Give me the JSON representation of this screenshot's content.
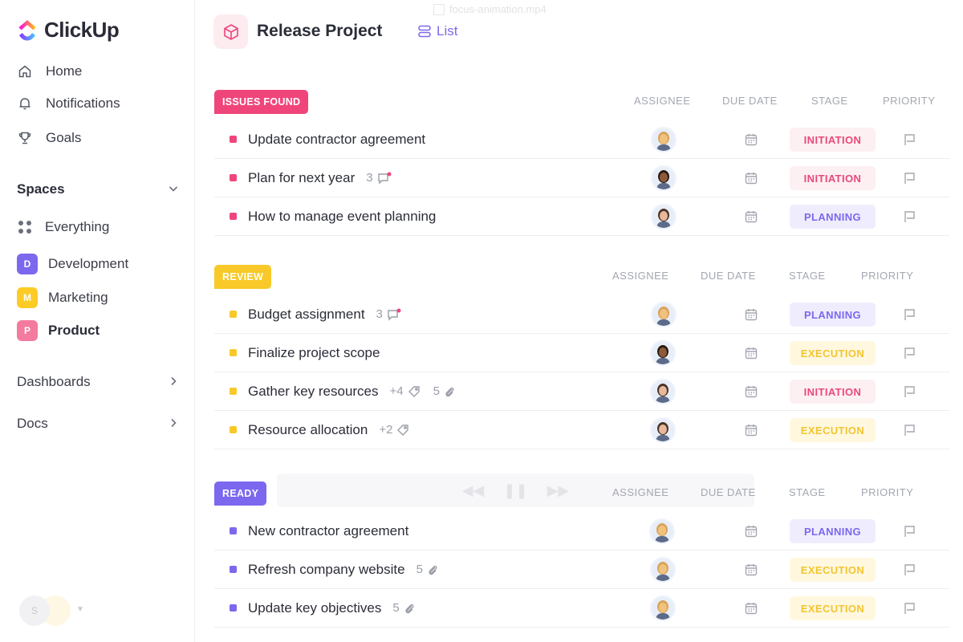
{
  "video": {
    "title": "focus-animation.mp4"
  },
  "sidebar": {
    "brand": "ClickUp",
    "nav": [
      {
        "label": "Home",
        "icon": "home-icon"
      },
      {
        "label": "Notifications",
        "icon": "bell-icon"
      },
      {
        "label": "Goals",
        "icon": "trophy-icon"
      }
    ],
    "spaces_label": "Spaces",
    "spaces": [
      {
        "label": "Everything",
        "letter": "",
        "color": ""
      },
      {
        "label": "Development",
        "letter": "D",
        "color": "#7b68ee"
      },
      {
        "label": "Marketing",
        "letter": "M",
        "color": "#fdcb26"
      },
      {
        "label": "Product",
        "letter": "P",
        "color": "#f47a9f"
      }
    ],
    "dashboards_label": "Dashboards",
    "docs_label": "Docs",
    "user_initial": "S"
  },
  "header": {
    "title": "Release Project",
    "view_tab": "List"
  },
  "columns": {
    "assignee": "ASSIGNEE",
    "due_date": "DUE DATE",
    "stage": "STAGE",
    "priority": "PRIORITY"
  },
  "groups": [
    {
      "label": "ISSUES FOUND",
      "color": "#f0457b",
      "tasks": [
        {
          "name": "Update contractor agreement",
          "stage": "INITIATION"
        },
        {
          "name": "Plan for next year",
          "comments": "3",
          "stage": "INITIATION"
        },
        {
          "name": "How to manage event planning",
          "stage": "PLANNING"
        }
      ]
    },
    {
      "label": "REVIEW",
      "color": "#f8c928",
      "tasks": [
        {
          "name": "Budget assignment",
          "comments": "3",
          "stage": "PLANNING"
        },
        {
          "name": "Finalize project scope",
          "stage": "EXECUTION"
        },
        {
          "name": "Gather key resources",
          "tags": "+4",
          "attachments": "5",
          "stage": "INITIATION"
        },
        {
          "name": "Resource allocation",
          "tags": "+2",
          "stage": "EXECUTION"
        }
      ]
    },
    {
      "label": "READY",
      "color": "#7b68ee",
      "tasks": [
        {
          "name": "New contractor agreement",
          "stage": "PLANNING"
        },
        {
          "name": "Refresh company website",
          "attachments": "5",
          "stage": "EXECUTION"
        },
        {
          "name": "Update key objectives",
          "attachments": "5",
          "stage": "EXECUTION"
        }
      ]
    }
  ]
}
